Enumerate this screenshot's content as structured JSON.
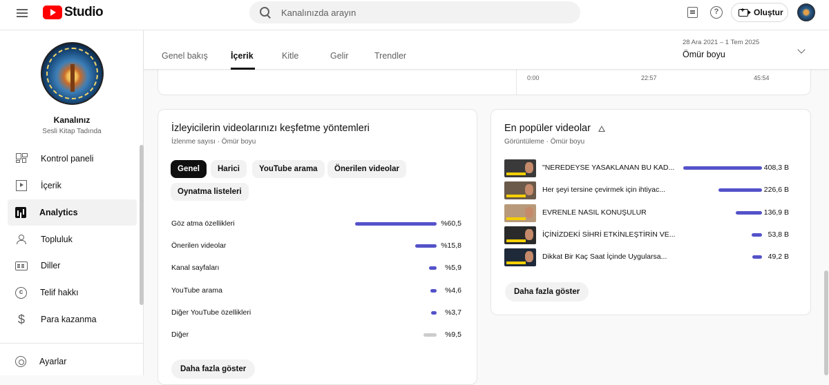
{
  "topbar": {
    "logo_text": "Studio",
    "search_placeholder": "Kanalınızda arayın",
    "create_label": "Oluştur"
  },
  "sidebar": {
    "channel_name": "Kanalınız",
    "channel_handle": "Sesli Kitap Tadında",
    "items": [
      {
        "label": "Kontrol paneli",
        "icon": "dashboard-icon"
      },
      {
        "label": "İçerik",
        "icon": "content-icon"
      },
      {
        "label": "Analytics",
        "icon": "analytics-icon",
        "active": true
      },
      {
        "label": "Topluluk",
        "icon": "community-icon"
      },
      {
        "label": "Diller",
        "icon": "subtitles-icon"
      },
      {
        "label": "Telif hakkı",
        "icon": "copyright-icon"
      },
      {
        "label": "Para kazanma",
        "icon": "dollar-icon"
      }
    ],
    "settings_label": "Ayarlar"
  },
  "tabs": [
    {
      "label": "Genel bakış"
    },
    {
      "label": "İçerik",
      "active": true
    },
    {
      "label": "Kitle"
    },
    {
      "label": "Gelir"
    },
    {
      "label": "Trendler"
    }
  ],
  "date_range": {
    "range": "28 Ara 2021 – 1 Tem 2025",
    "label": "Ömür boyu"
  },
  "timeline_axis": [
    "0:00",
    "22:57",
    "45:54"
  ],
  "discovery": {
    "title": "İzleyicilerin videolarınızı keşfetme yöntemleri",
    "subtitle": "İzlenme sayısı · Ömür boyu",
    "chips": [
      "Genel",
      "Harici",
      "YouTube arama",
      "Önerilen videolar",
      "Oynatma listeleri"
    ],
    "active_chip": "Genel",
    "rows": [
      {
        "label": "Göz atma özellikleri",
        "value": "%60,5",
        "pct": 60.5
      },
      {
        "label": "Önerilen videolar",
        "value": "%15,8",
        "pct": 15.8
      },
      {
        "label": "Kanal sayfaları",
        "value": "%5,9",
        "pct": 5.9
      },
      {
        "label": "YouTube arama",
        "value": "%4,6",
        "pct": 4.6
      },
      {
        "label": "Diğer YouTube özellikleri",
        "value": "%3,7",
        "pct": 3.7
      },
      {
        "label": "Diğer",
        "value": "%9,5",
        "pct": 9.5
      }
    ],
    "more_label": "Daha fazla göster"
  },
  "popular": {
    "title": "En popüler videolar",
    "subtitle": "Görüntüleme · Ömür boyu",
    "videos": [
      {
        "title": "\"NEREDEYSE YASAKLANAN BU KAD...",
        "value": "408,3 B",
        "views_k": 408.3,
        "thumb_bg": "#3a3a3a"
      },
      {
        "title": "Her şeyi tersine çevirmek için ihtiyac...",
        "value": "226,6 B",
        "views_k": 226.6,
        "thumb_bg": "#6b5a4a"
      },
      {
        "title": "EVRENLE NASIL KONUŞULUR",
        "value": "136,9 B",
        "views_k": 136.9,
        "thumb_bg": "#b89a7a"
      },
      {
        "title": "İÇİNİZDEKİ SİHRİ ETKİNLEŞTİRİN VE...",
        "value": "53,8 B",
        "views_k": 53.8,
        "thumb_bg": "#2a2a2a"
      },
      {
        "title": "Dikkat Bir Kaç Saat İçinde Uygularsa...",
        "value": "49,2 B",
        "views_k": 49.2,
        "thumb_bg": "#1e2a3a"
      }
    ],
    "more_label": "Daha fazla göster"
  },
  "colors": {
    "accent_bar": "#5452c9",
    "other_bar": "#cccccc",
    "brand_red": "#ff0000"
  }
}
